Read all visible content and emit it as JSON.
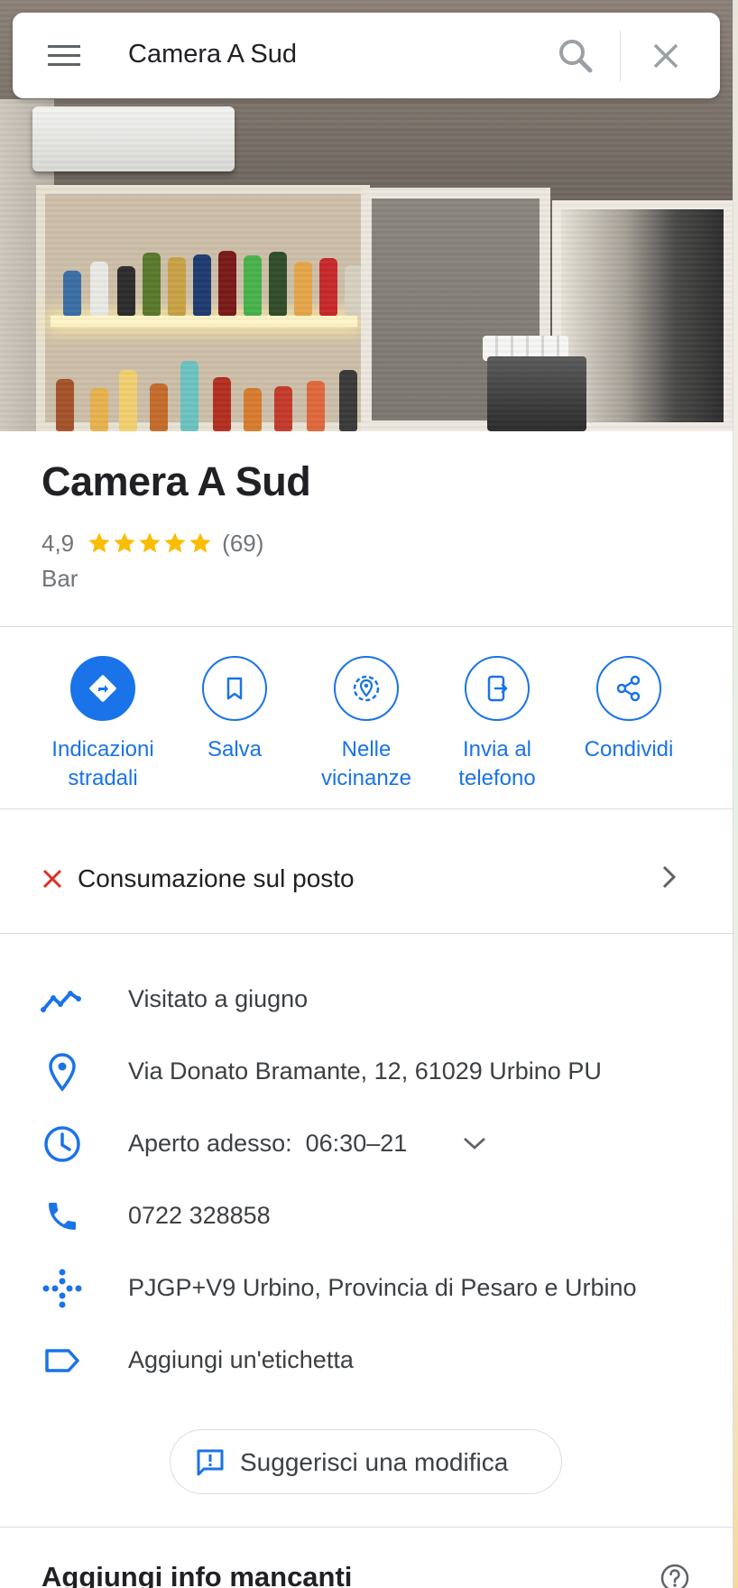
{
  "search": {
    "query": "Camera A Sud"
  },
  "place": {
    "name": "Camera A Sud",
    "rating": "4,9",
    "rating_value": 4.9,
    "reviews": "(69)",
    "category": "Bar"
  },
  "actions": [
    {
      "line1": "Indicazioni",
      "line2": "stradali",
      "icon": "directions-icon"
    },
    {
      "line1": "Salva",
      "line2": "",
      "icon": "bookmark-icon"
    },
    {
      "line1": "Nelle",
      "line2": "vicinanze",
      "icon": "nearby-icon"
    },
    {
      "line1": "Invia al",
      "line2": "telefono",
      "icon": "send-to-phone-icon"
    },
    {
      "line1": "Condividi",
      "line2": "",
      "icon": "share-icon"
    }
  ],
  "dine_in": {
    "label": "Consumazione sul posto"
  },
  "info": {
    "visited": "Visitato a giugno",
    "address": "Via Donato Bramante, 12, 61029 Urbino PU",
    "hours_label": "Aperto adesso:",
    "hours_value": "06:30–21",
    "phone": "0722 328858",
    "plus_code": "PJGP+V9 Urbino, Provincia di Pesaro e Urbino",
    "label": "Aggiungi un'etichetta"
  },
  "suggest_edit": "Suggerisci una modifica",
  "missing_info": "Aggiungi info mancanti",
  "colors": {
    "accent": "#1a73e8",
    "star": "#fbbc04",
    "closed": "#d93025"
  }
}
